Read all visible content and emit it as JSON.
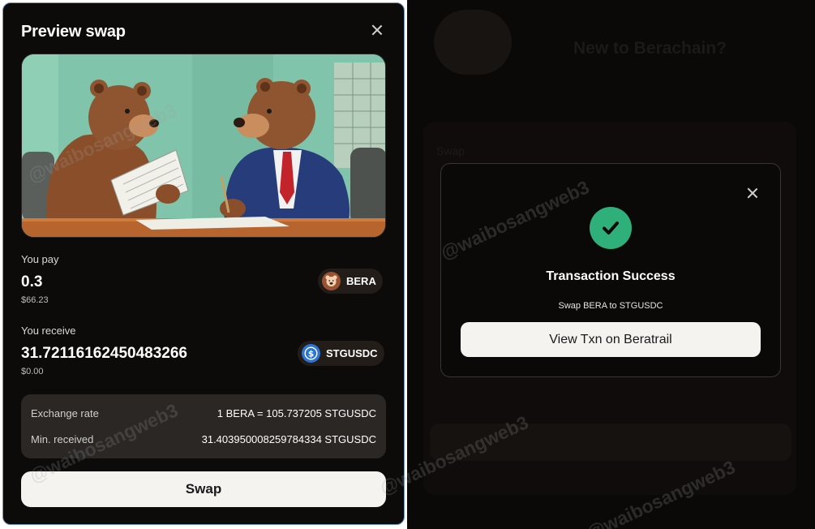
{
  "preview": {
    "title": "Preview swap",
    "pay": {
      "label": "You pay",
      "amount": "0.3",
      "usd": "$66.23",
      "token": "BERA"
    },
    "receive": {
      "label": "You receive",
      "amount": "31.72116162450483266",
      "usd": "$0.00",
      "token": "STGUSDC"
    },
    "exchange_rate": {
      "label": "Exchange rate",
      "value": "1 BERA = 105.737205 STGUSDC"
    },
    "min_received": {
      "label": "Min. received",
      "value": "31.403950008259784334 STGUSDC"
    },
    "swap_button": "Swap"
  },
  "success_modal": {
    "title": "Transaction Success",
    "subtitle": "Swap BERA to STGUSDC",
    "button": "View Txn on Beratrail"
  },
  "background": {
    "title": "New to Berachain?",
    "swap_label": "Swap"
  },
  "watermark": "@waibosangweb3",
  "colors": {
    "panel_bg": "#0d0b0a",
    "accent_border": "#6f96c9",
    "success_green": "#2fb07a",
    "button_bg": "#f5f3f0",
    "usdc_blue": "#2b74d4",
    "bera_brown": "#9a5231"
  },
  "icons": [
    "close-icon",
    "bera-token-icon",
    "usdc-token-icon",
    "check-icon"
  ]
}
